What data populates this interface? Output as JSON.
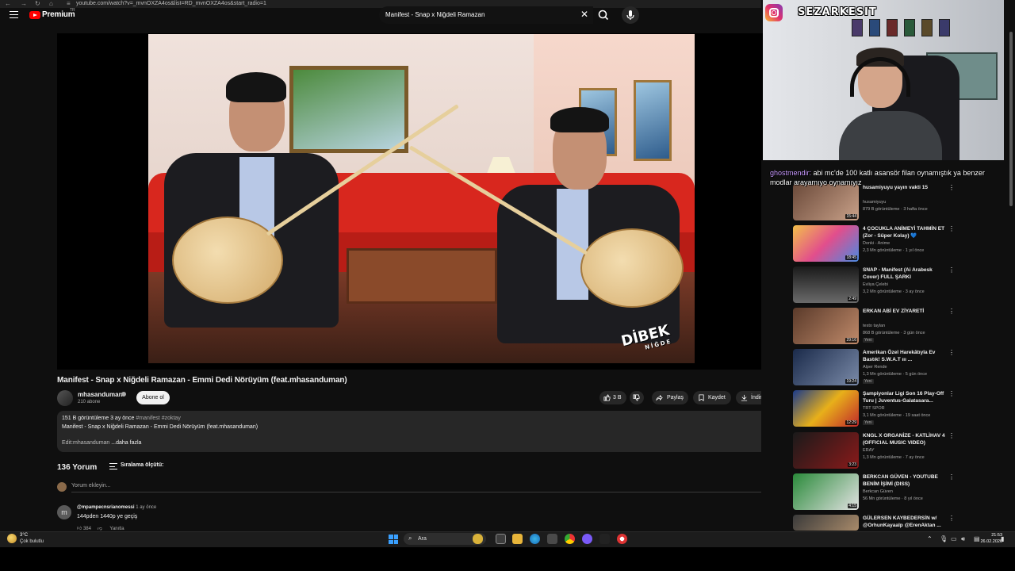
{
  "browser": {
    "url": "youtube.com/watch?v=_mvnOXZA4os&list=RD_mvnOXZA4os&start_radio=1"
  },
  "masthead": {
    "logo_text": "Premium",
    "region": "TR",
    "search_value": "Manifest - Snap x Niğdeli Ramazan"
  },
  "video": {
    "watermark": "DİBEK",
    "watermark_sub": "NİĞDE",
    "title": "Manifest - Snap x Niğdeli Ramazan - Emmi Dedi Nörüyüm (feat.mhasanduman)",
    "channel": "mhasanduman",
    "subscribers": "210 abone",
    "subscribe_label": "Abone ol",
    "likes": "3 B",
    "share_label": "Paylaş",
    "save_label": "Kaydet",
    "download_label": "İndir"
  },
  "description": {
    "stats": "151 B görüntüleme  3 ay önce",
    "tags": "#manifest #zoktay",
    "line2": "Manifest - Snap x Niğdeli Ramazan - Emmi Dedi Nörüyüm (feat.mhasanduman)",
    "line3": "Edit:mhasanduman",
    "more": "...daha fazla"
  },
  "comments": {
    "count": "136 Yorum",
    "sort_label": "Sıralama ölçütü:",
    "add_placeholder": "Yorum ekleyin...",
    "items": [
      {
        "avatar_letter": "m",
        "author": "@mpampecnsrianomessi",
        "ago": "1 ay önce",
        "text": "144pden 1440p ye geçiş",
        "likes": "384",
        "reply": "Yanıtla"
      }
    ]
  },
  "stream": {
    "ig_handle": "SEZARKESIT",
    "chat_user": "ghostmendir:",
    "chat_text": "abi mc'de 100 katlı asansör filan oynamıştık ya benzer modlar arayamıyo oynamıyız"
  },
  "recommendations": [
    {
      "title": "husamiyuyu yayın vakti 15",
      "channel": "husamiyuyu",
      "meta": "879 B görüntüleme · 3 hafta önce",
      "duration": "15:44",
      "badge": ""
    },
    {
      "title": "4 ÇOCUKLA ANİMEYİ TAHMİN ET (Zor - Süper Kolay) 💙",
      "channel": "Donki - Anime",
      "meta": "2,3 Mn görüntüleme · 1 yıl önce",
      "duration": "18:45",
      "badge": ""
    },
    {
      "title": "SNAP - Manifest (Ai Arabesk Cover) FULL ŞARKI",
      "channel": "Evliya Çelebi",
      "meta": "3,2 Mn görüntüleme · 3 ay önce",
      "duration": "2:49",
      "badge": ""
    },
    {
      "title": "ERKAN ABİ EV ZİYARETİ",
      "channel": "testo taylan",
      "meta": "868 B görüntüleme · 3 gün önce",
      "duration": "29:16",
      "badge": "Yeni"
    },
    {
      "title": "Amerikan Özel Harekâtıyla Ev Bastık! S.W.A.T ııı ...",
      "channel": "Alper Rende",
      "meta": "1,3 Mn görüntüleme · 5 gün önce",
      "duration": "19:24",
      "badge": "Yeni"
    },
    {
      "title": "Şampiyonlar Ligi Son 16 Play-Off Turu | Juventus-Galatasara...",
      "channel": "TRT SPOR",
      "meta": "3,1 Mn görüntüleme · 19 saat önce",
      "duration": "12:29",
      "badge": "Yeni"
    },
    {
      "title": "KNGL X ORGANİZE - KATLİHAV 4 (OFFICIAL MUSIC VIDEO)",
      "channel": "ERAY",
      "meta": "1,3 Mn görüntüleme · 7 ay önce",
      "duration": "3:23",
      "badge": ""
    },
    {
      "title": "BERKCAN GÜVEN - YOUTUBE BENİM İŞİMİ (DISS)",
      "channel": "Berkcan Güven",
      "meta": "56 Mn görüntüleme · 8 yıl önce",
      "duration": "4:15",
      "badge": ""
    },
    {
      "title": "GÜLERSEN KAYBEDERSİN w/ @OrhunKayaalp @ErenAktan ...",
      "channel": "",
      "meta": "",
      "duration": "",
      "badge": ""
    }
  ],
  "taskbar": {
    "temp": "3°C",
    "weather": "Çok bulutlu",
    "search_label": "Ara",
    "time": "21:53",
    "date": "26.02.2026"
  },
  "colors": {
    "accent_red": "#ff0000",
    "chat_user": "#c89aff",
    "bg": "#0f0f0f",
    "pill": "#272727"
  }
}
